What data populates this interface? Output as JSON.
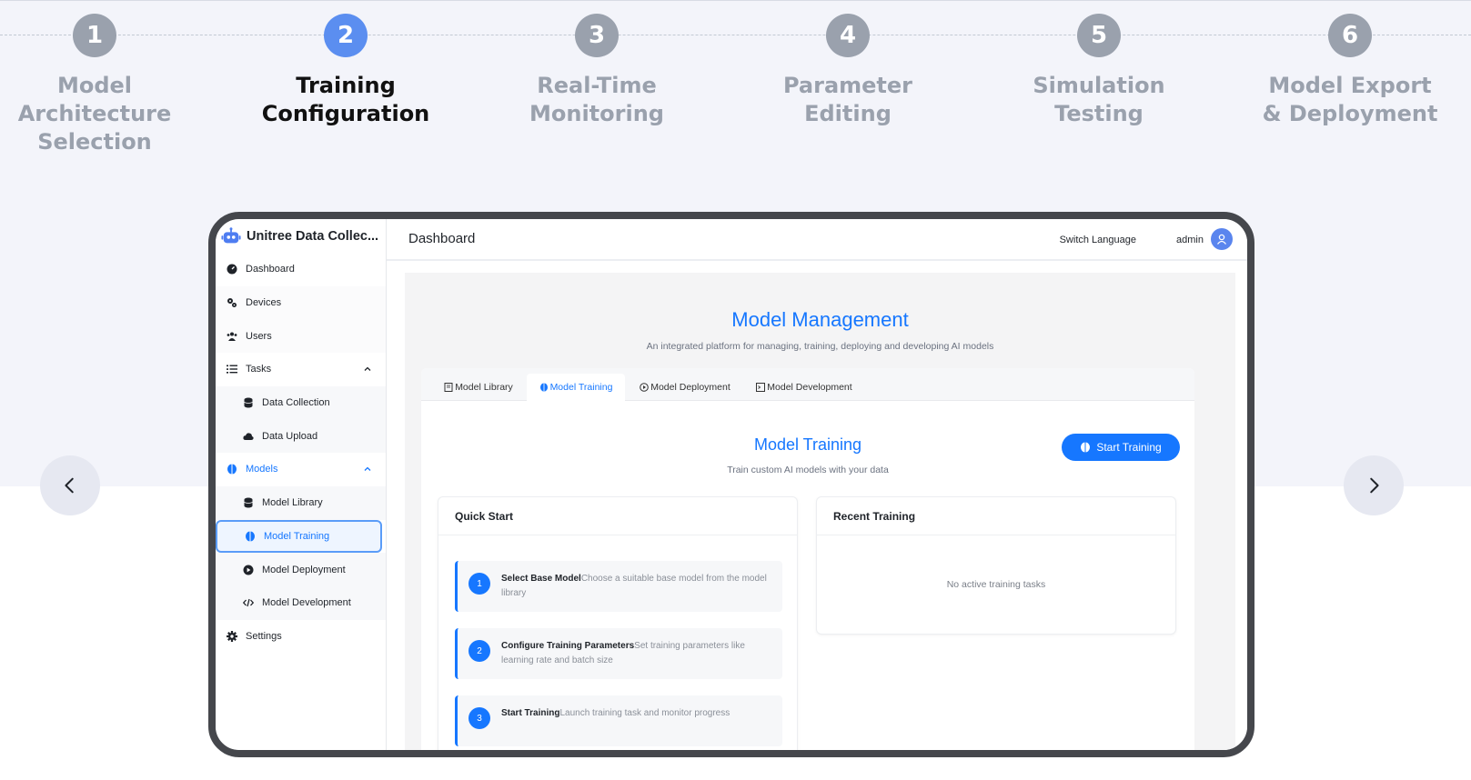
{
  "steps": [
    {
      "num": "1",
      "label": "Model\nArchitecture\nSelection"
    },
    {
      "num": "2",
      "label": "Training\nConfiguration"
    },
    {
      "num": "3",
      "label": "Real-Time\nMonitoring"
    },
    {
      "num": "4",
      "label": "Parameter\nEditing"
    },
    {
      "num": "5",
      "label": "Simulation\nTesting"
    },
    {
      "num": "6",
      "label": "Model Export\n& Deployment"
    }
  ],
  "active_step": 2,
  "colors": {
    "accent": "#1677ff",
    "step_active": "#5b8ef0",
    "step_inactive": "#9aa1ad",
    "device_frame": "#45474c"
  },
  "app": {
    "brand": "Unitree Data Collec...",
    "header": {
      "title": "Dashboard",
      "switch_language": "Switch Language",
      "user": "admin"
    },
    "sidebar": {
      "dashboard": "Dashboard",
      "devices": "Devices",
      "users": "Users",
      "tasks": "Tasks",
      "data_collection": "Data Collection",
      "data_upload": "Data Upload",
      "models": "Models",
      "model_library": "Model Library",
      "model_training": "Model Training",
      "model_deployment": "Model Deployment",
      "model_development": "Model Development",
      "settings": "Settings"
    },
    "page": {
      "title": "Model Management",
      "subtitle": "An integrated platform for managing, training, deploying and developing AI models"
    },
    "tabs": {
      "library": "Model Library",
      "training": "Model Training",
      "deployment": "Model Deployment",
      "development": "Model Development"
    },
    "training": {
      "title": "Model Training",
      "subtitle": "Train custom AI models with your data",
      "start_button": "Start Training"
    },
    "quick_start": {
      "title": "Quick Start",
      "items": [
        {
          "num": "1",
          "title": "Select Base Model",
          "desc": "Choose a suitable base model from the model library"
        },
        {
          "num": "2",
          "title": "Configure Training Parameters",
          "desc": "Set training parameters like learning rate and batch size"
        },
        {
          "num": "3",
          "title": "Start Training",
          "desc": "Launch training task and monitor progress"
        }
      ]
    },
    "recent_training": {
      "title": "Recent Training",
      "empty": "No active training tasks"
    }
  },
  "icons": [
    "dashboard-icon",
    "devices-icon",
    "users-icon",
    "tasks-icon",
    "database-icon",
    "cloud-icon",
    "brain-icon",
    "play-circle-icon",
    "code-icon",
    "gear-icon",
    "chevron-left-icon",
    "chevron-right-icon",
    "user-icon",
    "robot-icon"
  ]
}
